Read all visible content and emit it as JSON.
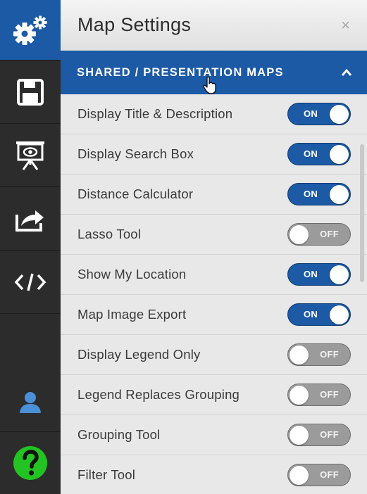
{
  "panel": {
    "title": "Map Settings",
    "close_glyph": "×",
    "section": {
      "label": "SHARED / PRESENTATION MAPS",
      "icon": "chevron-up-icon"
    }
  },
  "rail": {
    "items": [
      {
        "icon": "settings-gears-icon",
        "active": true
      },
      {
        "icon": "save-icon",
        "active": false
      },
      {
        "icon": "presentation-view-icon",
        "active": false
      },
      {
        "icon": "share-icon",
        "active": false
      },
      {
        "icon": "embed-code-icon",
        "active": false
      },
      {
        "icon": "user-icon",
        "active": false
      },
      {
        "icon": "help-icon",
        "active": false
      }
    ]
  },
  "settings": [
    {
      "label": "Display Title & Description",
      "state": "ON"
    },
    {
      "label": "Display Search Box",
      "state": "ON"
    },
    {
      "label": "Distance Calculator",
      "state": "ON"
    },
    {
      "label": "Lasso Tool",
      "state": "OFF"
    },
    {
      "label": "Show My Location",
      "state": "ON"
    },
    {
      "label": "Map Image Export",
      "state": "ON"
    },
    {
      "label": "Display Legend Only",
      "state": "OFF"
    },
    {
      "label": "Legend Replaces Grouping",
      "state": "OFF"
    },
    {
      "label": "Grouping Tool",
      "state": "OFF"
    },
    {
      "label": "Filter Tool",
      "state": "OFF"
    }
  ],
  "colors": {
    "accent": "#1c5aa6",
    "rail": "#2c2c2c",
    "help": "#22c322",
    "user": "#4a90d9"
  }
}
